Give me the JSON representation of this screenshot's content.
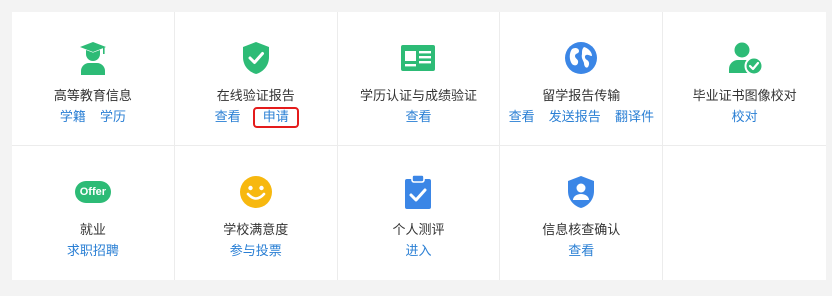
{
  "services": [
    {
      "title": "高等教育信息",
      "icon": "graduate-icon",
      "links": [
        "学籍",
        "学历"
      ]
    },
    {
      "title": "在线验证报告",
      "icon": "shield-check-icon",
      "links": [
        "查看",
        "申请"
      ]
    },
    {
      "title": "学历认证与成绩验证",
      "icon": "id-card-icon",
      "links": [
        "查看"
      ]
    },
    {
      "title": "留学报告传输",
      "icon": "globe-icon",
      "links": [
        "查看",
        "发送报告",
        "翻译件"
      ]
    },
    {
      "title": "毕业证书图像校对",
      "icon": "user-check-icon",
      "links": [
        "校对"
      ]
    },
    {
      "title": "就业",
      "icon": "offer-icon",
      "badge": "Offer",
      "links": [
        "求职招聘"
      ]
    },
    {
      "title": "学校满意度",
      "icon": "smiley-icon",
      "links": [
        "参与投票"
      ]
    },
    {
      "title": "个人测评",
      "icon": "clipboard-check-icon",
      "links": [
        "进入"
      ]
    },
    {
      "title": "信息核查确认",
      "icon": "user-shield-icon",
      "links": [
        "查看"
      ]
    }
  ],
  "colors": {
    "green": "#2dbb76",
    "blue": "#3b86e6",
    "yellow": "#f7b80f",
    "link": "#2a7fd4",
    "highlight": "#e41b1b"
  }
}
